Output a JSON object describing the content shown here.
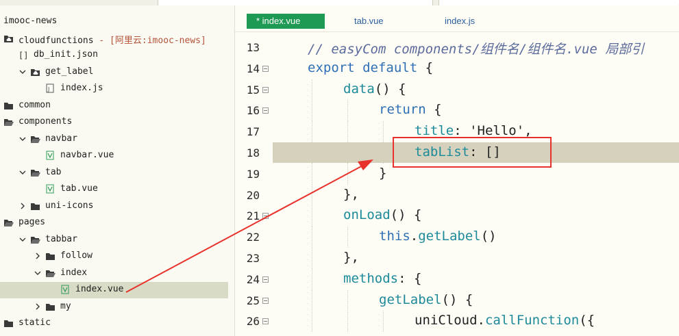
{
  "sidebar": {
    "items": [
      {
        "label": "imooc-news",
        "tag": "",
        "icon": "none",
        "arrow": "none",
        "indent": 0
      },
      {
        "label": "cloudfunctions",
        "tag": " - [阿里云:imooc-news]",
        "icon": "cloud-folder-icon",
        "arrow": "none",
        "indent": 0
      },
      {
        "label": "db_init.json",
        "tag": "",
        "icon": "json-file-icon",
        "arrow": "none",
        "indent": 1
      },
      {
        "label": "get_label",
        "tag": "",
        "icon": "cloud-folder-icon",
        "arrow": "down",
        "indent": 1
      },
      {
        "label": "index.js",
        "tag": "",
        "icon": "js-file-icon",
        "arrow": "none",
        "indent": 2
      },
      {
        "label": "common",
        "tag": "",
        "icon": "folder-icon",
        "arrow": "none",
        "indent": 0
      },
      {
        "label": "components",
        "tag": "",
        "icon": "folder-open-icon",
        "arrow": "none",
        "indent": 0
      },
      {
        "label": "navbar",
        "tag": "",
        "icon": "folder-open-icon",
        "arrow": "down",
        "indent": 1
      },
      {
        "label": "navbar.vue",
        "tag": "",
        "icon": "vue-file-icon",
        "arrow": "none",
        "indent": 2
      },
      {
        "label": "tab",
        "tag": "",
        "icon": "folder-open-icon",
        "arrow": "down",
        "indent": 1
      },
      {
        "label": "tab.vue",
        "tag": "",
        "icon": "vue-file-icon",
        "arrow": "none",
        "indent": 2
      },
      {
        "label": "uni-icons",
        "tag": "",
        "icon": "folder-icon",
        "arrow": "right",
        "indent": 1
      },
      {
        "label": "pages",
        "tag": "",
        "icon": "folder-open-icon",
        "arrow": "none",
        "indent": 0
      },
      {
        "label": "tabbar",
        "tag": "",
        "icon": "folder-open-icon",
        "arrow": "down",
        "indent": 1
      },
      {
        "label": "follow",
        "tag": "",
        "icon": "folder-icon",
        "arrow": "right",
        "indent": 2
      },
      {
        "label": "index",
        "tag": "",
        "icon": "folder-open-icon",
        "arrow": "down",
        "indent": 2
      },
      {
        "label": "index.vue",
        "tag": "",
        "icon": "vue-file-icon",
        "arrow": "none",
        "indent": 3,
        "selected": true
      },
      {
        "label": "my",
        "tag": "",
        "icon": "folder-icon",
        "arrow": "right",
        "indent": 2
      },
      {
        "label": "static",
        "tag": "",
        "icon": "folder-icon",
        "arrow": "none",
        "indent": 0
      }
    ]
  },
  "editor": {
    "tabs": [
      {
        "label": "* index.vue",
        "active": true
      },
      {
        "label": "tab.vue",
        "active": false
      },
      {
        "label": "index.js",
        "active": false
      }
    ],
    "lines": [
      {
        "num": "13",
        "fold": false,
        "indent": 0,
        "tokens": [
          [
            "cm",
            "// easyCom components/组件名/组件名.vue 局部引"
          ]
        ]
      },
      {
        "num": "14",
        "fold": true,
        "indent": 0,
        "tokens": [
          [
            "kw",
            "export default"
          ],
          [
            "str",
            " {"
          ]
        ]
      },
      {
        "num": "15",
        "fold": true,
        "indent": 1,
        "tokens": [
          [
            "fn",
            "data"
          ],
          [
            "str",
            "() {"
          ]
        ]
      },
      {
        "num": "16",
        "fold": true,
        "indent": 2,
        "tokens": [
          [
            "kw",
            "return"
          ],
          [
            "str",
            " {"
          ]
        ]
      },
      {
        "num": "17",
        "fold": false,
        "indent": 3,
        "tokens": [
          [
            "prop",
            "title"
          ],
          [
            "str",
            ": 'Hello',"
          ]
        ]
      },
      {
        "num": "18",
        "fold": false,
        "indent": 3,
        "tokens": [
          [
            "prop",
            "tabList"
          ],
          [
            "str",
            ": []"
          ]
        ]
      },
      {
        "num": "19",
        "fold": false,
        "indent": 2,
        "tokens": [
          [
            "str",
            "}"
          ]
        ]
      },
      {
        "num": "20",
        "fold": false,
        "indent": 1,
        "tokens": [
          [
            "str",
            "},"
          ]
        ]
      },
      {
        "num": "21",
        "fold": true,
        "indent": 1,
        "tokens": [
          [
            "fn",
            "onLoad"
          ],
          [
            "str",
            "() {"
          ]
        ]
      },
      {
        "num": "22",
        "fold": false,
        "indent": 2,
        "tokens": [
          [
            "kw",
            "this"
          ],
          [
            "str",
            "."
          ],
          [
            "fn",
            "getLabel"
          ],
          [
            "str",
            "()"
          ]
        ]
      },
      {
        "num": "23",
        "fold": false,
        "indent": 1,
        "tokens": [
          [
            "str",
            "},"
          ]
        ]
      },
      {
        "num": "24",
        "fold": true,
        "indent": 1,
        "tokens": [
          [
            "fn",
            "methods"
          ],
          [
            "str",
            ": {"
          ]
        ]
      },
      {
        "num": "25",
        "fold": true,
        "indent": 2,
        "tokens": [
          [
            "fn",
            "getLabel"
          ],
          [
            "str",
            "() {"
          ]
        ]
      },
      {
        "num": "26",
        "fold": true,
        "indent": 3,
        "tokens": [
          [
            "str",
            "uniCloud."
          ],
          [
            "fn",
            "callFunction"
          ],
          [
            "str",
            "({"
          ]
        ]
      }
    ]
  },
  "colors": {
    "active_tab": "#1f9a55",
    "annotation_red": "#e8312b",
    "keyword": "#2e6fb5",
    "function": "#1d8a9a"
  }
}
